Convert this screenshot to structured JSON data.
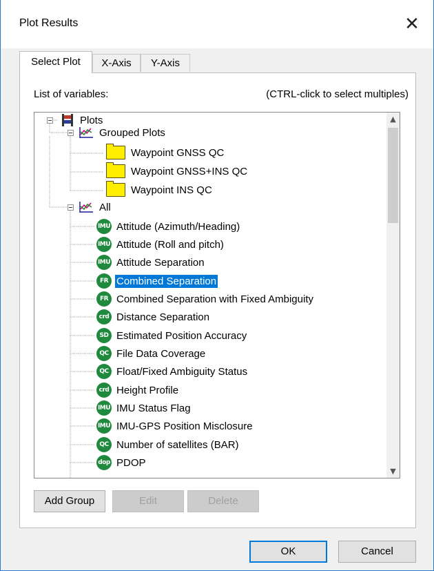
{
  "window": {
    "title": "Plot Results",
    "close_symbol": "✕"
  },
  "tabs": [
    {
      "label": "Select Plot",
      "active": true
    },
    {
      "label": "X-Axis",
      "active": false
    },
    {
      "label": "Y-Axis",
      "active": false
    }
  ],
  "panel": {
    "list_label": "List of variables:",
    "hint": "(CTRL-click to select multiples)"
  },
  "tree": {
    "root": {
      "label": "Plots",
      "icon": "plots-icon"
    },
    "grouped": {
      "label": "Grouped Plots",
      "icon": "graph-icon",
      "items": [
        {
          "label": "Waypoint GNSS QC",
          "icon": "folder-icon"
        },
        {
          "label": "Waypoint GNSS+INS QC",
          "icon": "folder-icon"
        },
        {
          "label": "Waypoint INS QC",
          "icon": "folder-icon"
        }
      ]
    },
    "all": {
      "label": "All",
      "icon": "graph-icon",
      "items": [
        {
          "badge": "IMU",
          "label": "Attitude (Azimuth/Heading)"
        },
        {
          "badge": "IMU",
          "label": "Attitude (Roll and pitch)"
        },
        {
          "badge": "IMU",
          "label": "Attitude Separation"
        },
        {
          "badge": "FR",
          "label": "Combined Separation",
          "selected": true
        },
        {
          "badge": "FR",
          "label": "Combined Separation with Fixed Ambiguity"
        },
        {
          "badge": "crd",
          "label": "Distance Separation"
        },
        {
          "badge": "SD",
          "label": "Estimated Position Accuracy"
        },
        {
          "badge": "QC",
          "label": "File Data Coverage"
        },
        {
          "badge": "QC",
          "label": "Float/Fixed Ambiguity Status"
        },
        {
          "badge": "crd",
          "label": "Height Profile"
        },
        {
          "badge": "IMU",
          "label": "IMU Status Flag"
        },
        {
          "badge": "IMU",
          "label": "IMU-GPS Position Misclosure"
        },
        {
          "badge": "QC",
          "label": "Number of satellites (BAR)"
        },
        {
          "badge": "dop",
          "label": "PDOP"
        }
      ]
    }
  },
  "scrollbar": {
    "up": "▲",
    "down": "▼"
  },
  "buttons": {
    "add_group": "Add Group",
    "edit": "Edit",
    "delete": "Delete",
    "ok": "OK",
    "cancel": "Cancel"
  },
  "colors": {
    "selection": "#0078d7",
    "badge": "#1f8a3d",
    "folder": "#ffee00",
    "accent_border": "#2b79d1"
  }
}
